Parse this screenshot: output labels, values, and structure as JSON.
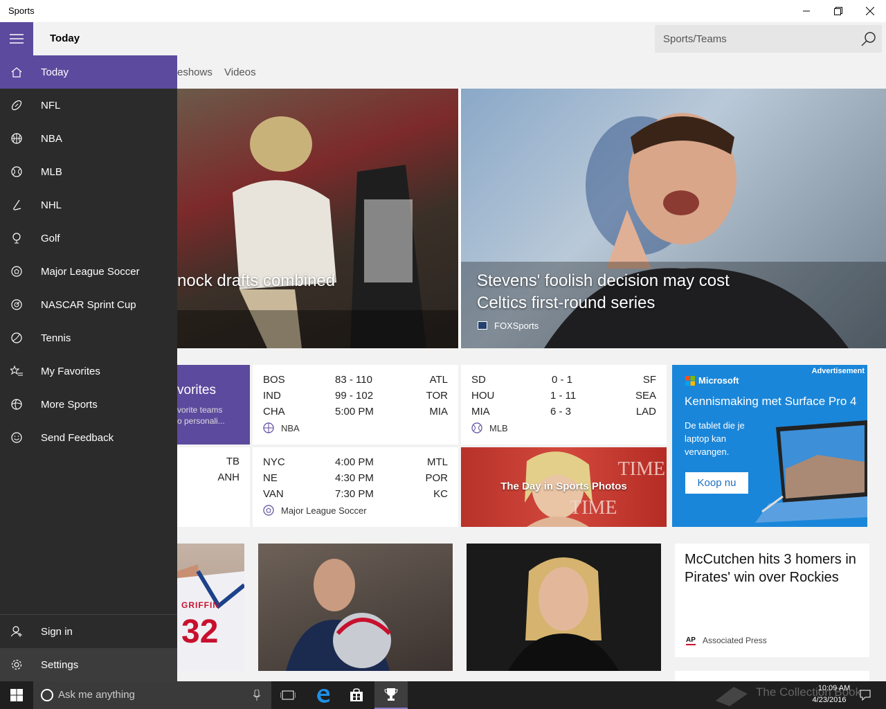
{
  "window": {
    "title": "Sports"
  },
  "header": {
    "page_title": "Today",
    "search_placeholder": "Sports/Teams"
  },
  "tabs": [
    {
      "label": "eshows"
    },
    {
      "label": "Videos"
    }
  ],
  "heroes": [
    {
      "title": "nock drafts combined"
    },
    {
      "title_line1": "Stevens' foolish decision may cost",
      "title_line2": "Celtics first-round series",
      "source": "FOXSports"
    }
  ],
  "favorites_tile": {
    "title": "vorites",
    "line1": "vorite teams",
    "line2": "o personali..."
  },
  "partial_tile": {
    "row1": "TB",
    "row2": "ANH"
  },
  "nba_tile": {
    "league": "NBA",
    "rows": [
      {
        "home": "BOS",
        "score": "83  -  110",
        "away": "ATL"
      },
      {
        "home": "IND",
        "score": "99  -  102",
        "away": "TOR"
      },
      {
        "home": "CHA",
        "score": "5:00 PM",
        "away": "MIA"
      }
    ]
  },
  "mlb_tile": {
    "league": "MLB",
    "rows": [
      {
        "home": "SD",
        "score": "0  -  1",
        "away": "SF"
      },
      {
        "home": "HOU",
        "score": "1  -  11",
        "away": "SEA"
      },
      {
        "home": "MIA",
        "score": "6  -  3",
        "away": "LAD"
      }
    ]
  },
  "mls_tile": {
    "league": "Major League Soccer",
    "rows": [
      {
        "home": "NYC",
        "score": "4:00 PM",
        "away": "MTL"
      },
      {
        "home": "NE",
        "score": "4:30 PM",
        "away": "POR"
      },
      {
        "home": "VAN",
        "score": "7:30 PM",
        "away": "KC"
      }
    ]
  },
  "photos_tile": {
    "label": "The Day in Sports Photos",
    "bg_text1": "TIME",
    "bg_text2": "TIME"
  },
  "ad": {
    "badge": "Advertisement",
    "brand": "Microsoft",
    "headline": "Kennismaking met Surface Pro 4",
    "body_line1": "De tablet die je",
    "body_line2": "laptop kan",
    "body_line3": "vervangen.",
    "cta": "Koop nu"
  },
  "bottom_tiles": {
    "jersey_name": "GRIFFIN",
    "jersey_number": "32",
    "news_line1": "McCutchen hits 3 homers in",
    "news_line2": "Pirates' win over Rockies",
    "news_source_badge": "AP",
    "news_source": "Associated Press"
  },
  "nav": {
    "items": [
      {
        "label": "Today",
        "icon": "home-icon"
      },
      {
        "label": "NFL",
        "icon": "football-icon"
      },
      {
        "label": "NBA",
        "icon": "basketball-icon"
      },
      {
        "label": "MLB",
        "icon": "baseball-icon"
      },
      {
        "label": "NHL",
        "icon": "hockey-icon"
      },
      {
        "label": "Golf",
        "icon": "golf-icon"
      },
      {
        "label": "Major League Soccer",
        "icon": "soccer-icon"
      },
      {
        "label": "NASCAR Sprint Cup",
        "icon": "racing-icon"
      },
      {
        "label": "Tennis",
        "icon": "tennis-icon"
      },
      {
        "label": "My Favorites",
        "icon": "star-list-icon"
      },
      {
        "label": "More Sports",
        "icon": "sports-ball-icon"
      },
      {
        "label": "Send Feedback",
        "icon": "smiley-icon"
      }
    ],
    "sign_in": "Sign in",
    "settings": "Settings"
  },
  "taskbar": {
    "search_placeholder": "Ask me anything",
    "time": "10:09 AM",
    "date": "4/23/2016",
    "watermark": "The Collection Book"
  },
  "colors": {
    "accent": "#5c4a9e",
    "nav_bg": "#2b2b2b",
    "ad_bg": "#1a86d9",
    "photo_tile_bg": "#c0392b"
  }
}
